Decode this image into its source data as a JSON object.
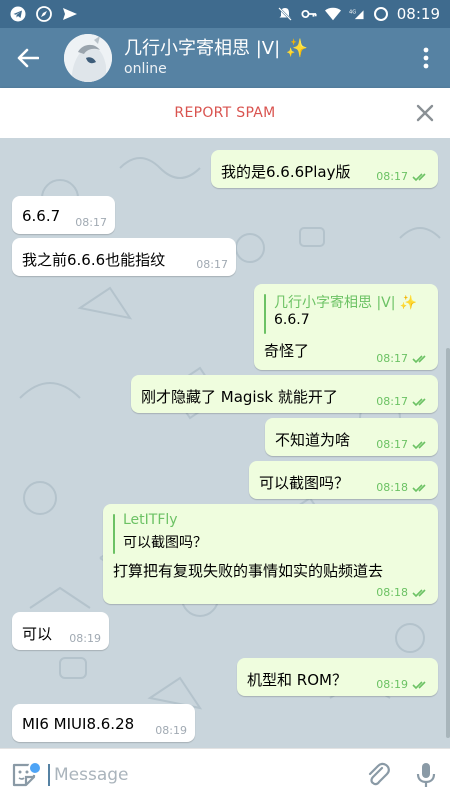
{
  "status_bar": {
    "time": "08:19",
    "network": "4G"
  },
  "header": {
    "title": "几行小字寄相思 |V| ✨",
    "subtitle": "online"
  },
  "report": {
    "label": "REPORT SPAM"
  },
  "messages": [
    {
      "dir": "out",
      "text": "我的是6.6.6Play版",
      "time": "08:17",
      "read": true
    },
    {
      "dir": "in",
      "text": "6.6.7",
      "time": "08:17"
    },
    {
      "dir": "in",
      "text": "我之前6.6.6也能指纹",
      "time": "08:17"
    },
    {
      "dir": "out",
      "reply_author": "几行小字寄相思 |V| ✨",
      "reply_text": "6.6.7",
      "text": "奇怪了",
      "time": "08:17",
      "read": true
    },
    {
      "dir": "out",
      "text": "刚才隐藏了 Magisk 就能开了",
      "time": "08:17",
      "read": true
    },
    {
      "dir": "out",
      "text": "不知道为啥",
      "time": "08:17",
      "read": true
    },
    {
      "dir": "out",
      "text": "可以截图吗？",
      "time": "08:18",
      "read": true
    },
    {
      "dir": "out",
      "reply_author": "LetITFly",
      "reply_text": "可以截图吗？",
      "text": "打算把有复现失败的事情如实的贴频道去",
      "time": "08:18",
      "read": true
    },
    {
      "dir": "in",
      "text": "可以",
      "time": "08:19"
    },
    {
      "dir": "out",
      "text": "机型和 ROM？",
      "time": "08:19",
      "read": true
    },
    {
      "dir": "in",
      "text": "MI6 MIUI8.6.28",
      "time": "08:19"
    }
  ],
  "input": {
    "placeholder": "Message"
  },
  "colors": {
    "header": "#5682a3",
    "statusbar": "#3f6b8e",
    "outgoing": "#effdde",
    "check": "#6cc264",
    "report": "#d9534f"
  }
}
